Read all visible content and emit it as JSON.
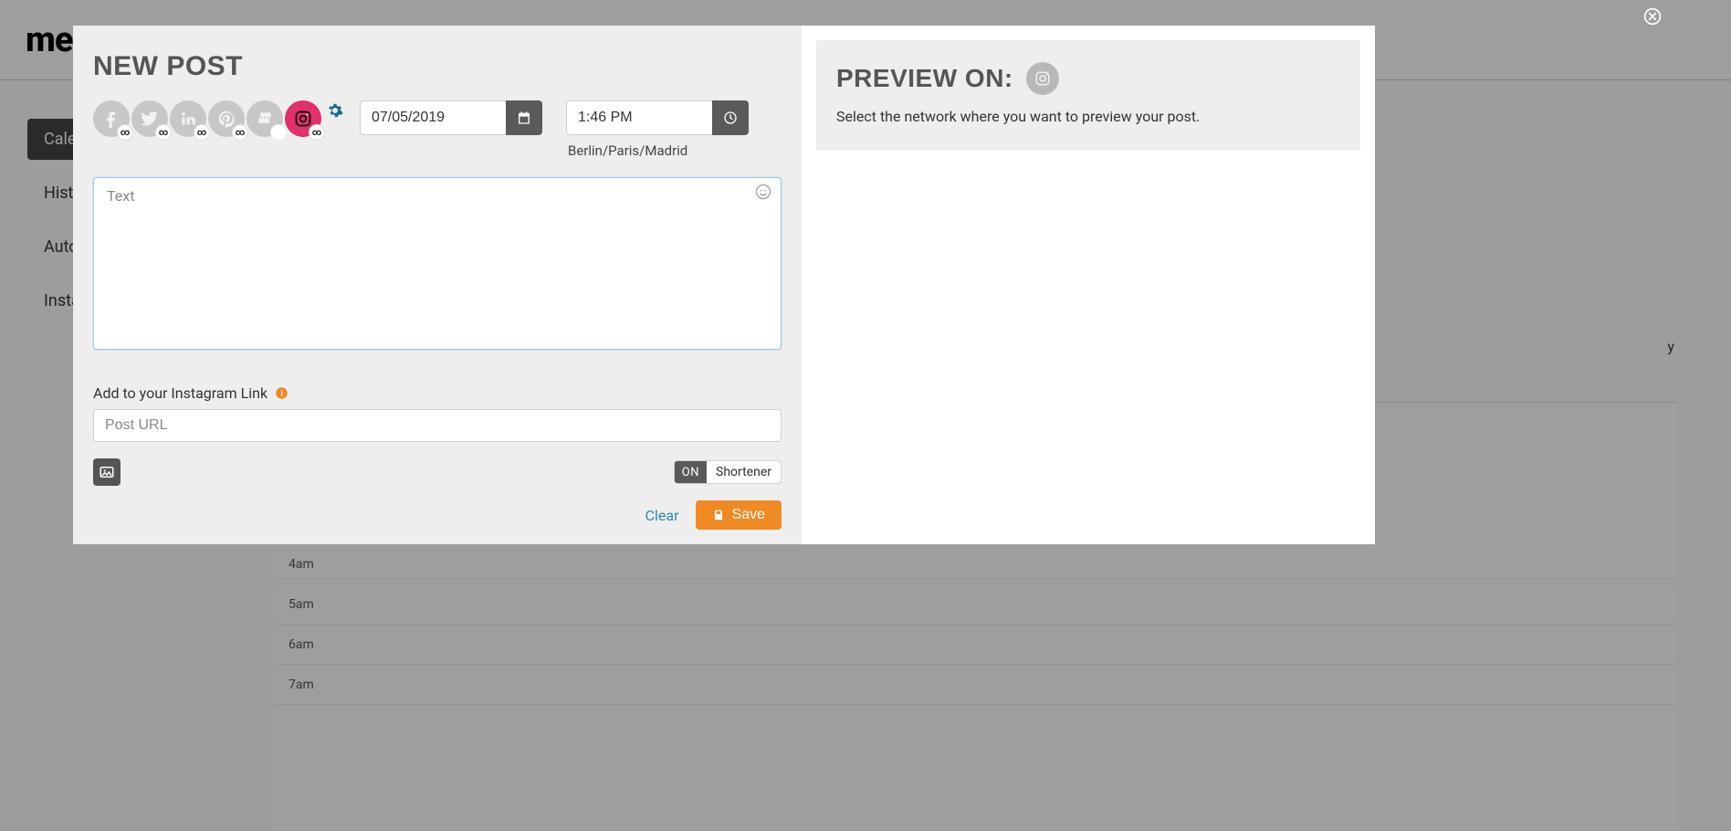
{
  "post": {
    "title": "NEW POST",
    "networks": [
      {
        "id": "facebook",
        "active": false,
        "badge": "∞"
      },
      {
        "id": "twitter",
        "active": false,
        "badge": "∞"
      },
      {
        "id": "linkedin",
        "active": false,
        "badge": "∞"
      },
      {
        "id": "pinterest",
        "active": false,
        "badge": "∞"
      },
      {
        "id": "gmb",
        "active": false,
        "badge": ""
      },
      {
        "id": "instagram",
        "active": true,
        "badge": "∞"
      }
    ],
    "date_value": "07/05/2019",
    "time_value": "1:46 PM",
    "timezone": "Berlin/Paris/Madrid",
    "text_placeholder": "Text",
    "link_label": "Add to your Instagram Link",
    "url_placeholder": "Post URL",
    "shortener_on": "ON",
    "shortener_label": "Shortener",
    "clear_label": "Clear",
    "save_label": "Save"
  },
  "preview": {
    "title": "PREVIEW ON:",
    "text": "Select the network where you want to preview your post."
  },
  "background": {
    "logo": "me",
    "sidebar": [
      "Cale",
      "Histo",
      "Auto",
      "Insta"
    ],
    "day_header": "y",
    "hours": [
      "4am",
      "5am",
      "6am",
      "7am"
    ]
  }
}
